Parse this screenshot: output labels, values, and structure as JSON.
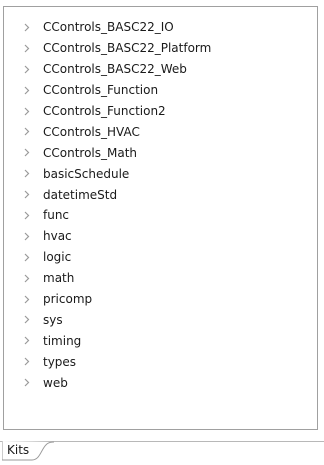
{
  "kits_view": {
    "items": [
      {
        "label": "CControls_BASC22_IO"
      },
      {
        "label": "CControls_BASC22_Platform"
      },
      {
        "label": "CControls_BASC22_Web"
      },
      {
        "label": "CControls_Function"
      },
      {
        "label": "CControls_Function2"
      },
      {
        "label": "CControls_HVAC"
      },
      {
        "label": "CControls_Math"
      },
      {
        "label": "basicSchedule"
      },
      {
        "label": "datetimeStd"
      },
      {
        "label": "func"
      },
      {
        "label": "hvac"
      },
      {
        "label": "logic"
      },
      {
        "label": "math"
      },
      {
        "label": "pricomp"
      },
      {
        "label": "sys"
      },
      {
        "label": "timing"
      },
      {
        "label": "types"
      },
      {
        "label": "web"
      }
    ],
    "expander_icon": "chevron-right-icon"
  },
  "tabs": [
    {
      "label": "Kits",
      "active": true
    }
  ],
  "colors": {
    "text": "#1a1a1a",
    "chevron": "#9a9a9a",
    "border": "#a0a0a0"
  }
}
